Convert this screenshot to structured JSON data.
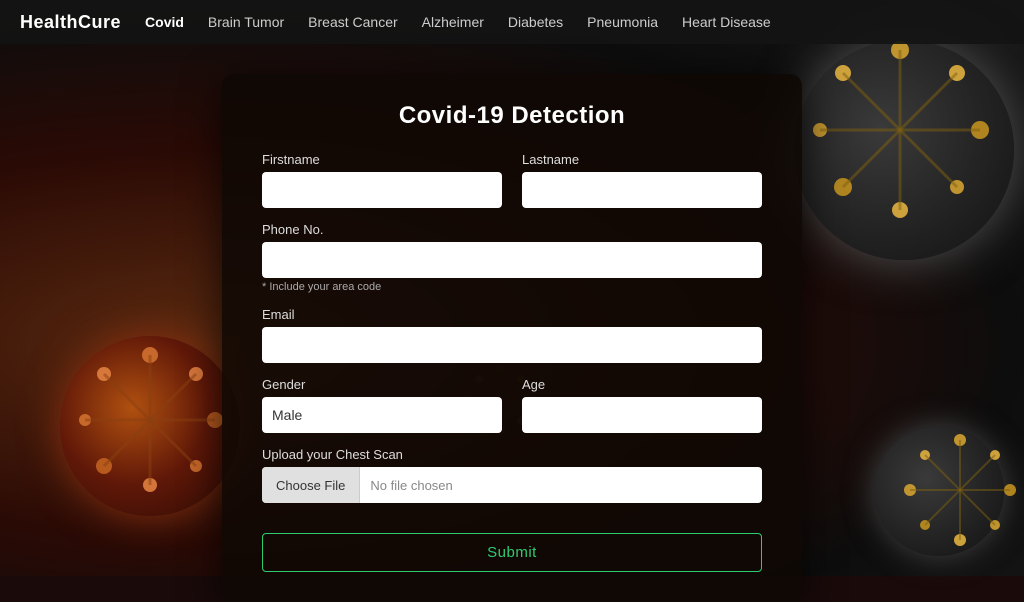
{
  "navbar": {
    "brand": "HealthCure",
    "links": [
      {
        "label": "Covid",
        "active": true
      },
      {
        "label": "Brain Tumor",
        "active": false
      },
      {
        "label": "Breast Cancer",
        "active": false
      },
      {
        "label": "Alzheimer",
        "active": false
      },
      {
        "label": "Diabetes",
        "active": false
      },
      {
        "label": "Pneumonia",
        "active": false
      },
      {
        "label": "Heart Disease",
        "active": false
      }
    ]
  },
  "form": {
    "title": "Covid-19 Detection",
    "fields": {
      "firstname_label": "Firstname",
      "lastname_label": "Lastname",
      "phone_label": "Phone No.",
      "phone_hint": "* Include your area code",
      "email_label": "Email",
      "gender_label": "Gender",
      "gender_value": "Male",
      "age_label": "Age",
      "upload_label": "Upload your Chest Scan",
      "file_btn": "Choose File",
      "file_placeholder": "No file chosen",
      "submit_label": "Submit"
    }
  }
}
